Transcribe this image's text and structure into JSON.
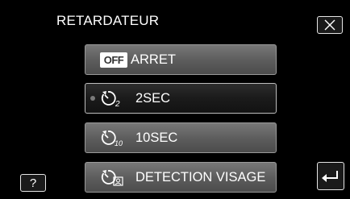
{
  "header": {
    "title": "RETARDATEUR"
  },
  "items": [
    {
      "label": "ARRET",
      "icon": "off-icon",
      "icon_text": "OFF",
      "selected": false
    },
    {
      "label": "2SEC",
      "icon": "self-timer-2s-icon",
      "icon_sub": "2",
      "selected": true
    },
    {
      "label": "10SEC",
      "icon": "self-timer-10s-icon",
      "icon_sub": "10",
      "selected": false
    },
    {
      "label": "DETECTION VISAGE",
      "icon": "self-timer-face-detection-icon",
      "selected": false
    }
  ],
  "help": {
    "label": "?"
  },
  "colors": {
    "background": "#000000",
    "button": "#5e5e5e",
    "selected_button": "#1b1b1b",
    "text": "#ffffff"
  }
}
